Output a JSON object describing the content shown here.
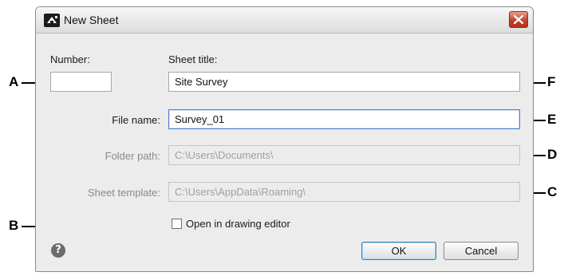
{
  "window": {
    "title": "New Sheet",
    "app_icon": "autocad-sheet-icon",
    "close_icon": "close-icon"
  },
  "fields": {
    "number": {
      "label": "Number:",
      "value": ""
    },
    "sheet_title": {
      "label": "Sheet title:",
      "value": "Site Survey"
    },
    "file_name": {
      "label": "File name:",
      "value": "Survey_01"
    },
    "folder_path": {
      "label": "Folder path:",
      "value": "C:\\Users\\Documents\\"
    },
    "sheet_template": {
      "label": "Sheet template:",
      "value": "C:\\Users\\AppData\\Roaming\\"
    }
  },
  "open_in_editor": {
    "label": "Open in drawing editor",
    "checked": false
  },
  "buttons": {
    "ok": "OK",
    "cancel": "Cancel"
  },
  "help_icon": "help-icon",
  "callouts": {
    "A": "A",
    "B": "B",
    "C": "C",
    "D": "D",
    "E": "E",
    "F": "F"
  }
}
